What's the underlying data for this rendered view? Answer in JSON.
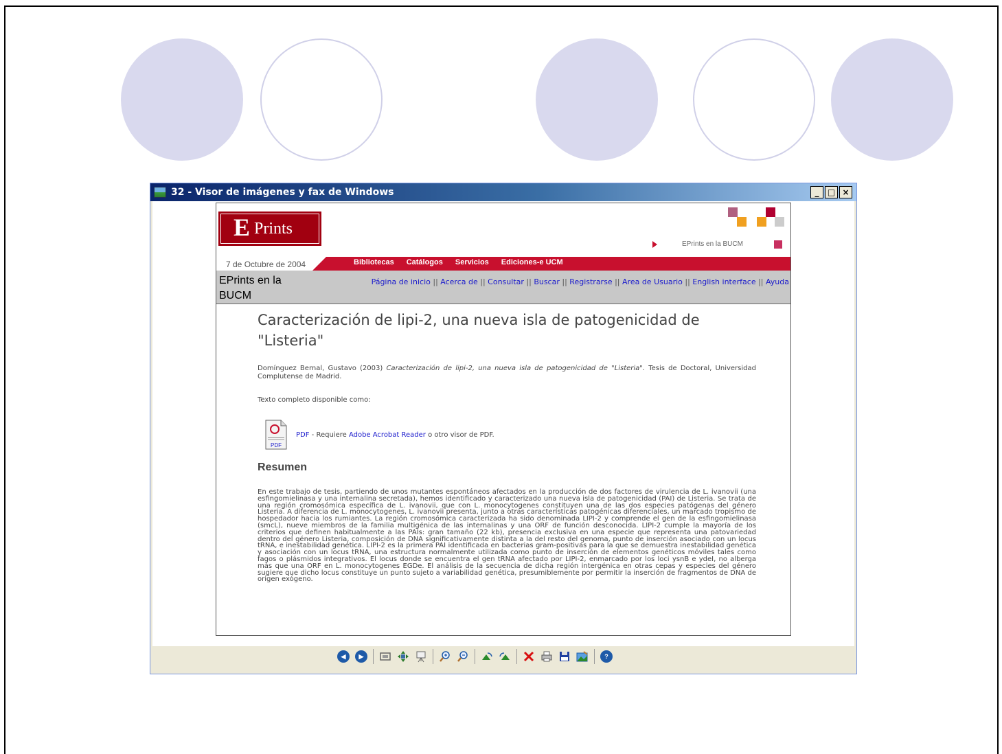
{
  "window": {
    "title": "32 - Visor de imágenes y fax de Windows",
    "min_label": "_",
    "max_label": "□",
    "close_label": "×"
  },
  "page": {
    "logo_letter": "E",
    "logo_rest": "Prints",
    "eprints_link": "EPrints en la BUCM",
    "date": "7 de Octubre de 2004",
    "nav": [
      "Bibliotecas",
      "Catálogos",
      "Servicios",
      "Ediciones-e UCM"
    ],
    "site_name": "EPrints en la BUCM",
    "top_links": [
      "Página de inicio",
      "Acerca de",
      "Consultar",
      "Buscar",
      "Registrarse",
      "Area de Usuario",
      "English interface",
      "Ayuda"
    ],
    "title": "Caracterización de lipi-2, una nueva isla de patogenicidad de \"Listeria\"",
    "citation_pre": "Domínguez Bernal, Gustavo (2003) ",
    "citation_italic": "Caracterización de lipi-2, una nueva isla de patogenicidad de \"Listeria\".",
    "citation_post": " Tesis de Doctoral, Universidad Complutense de Madrid.",
    "fulltext_label": "Texto completo disponible como:",
    "pdf_label": "PDF",
    "pdf_requires": " - Requiere ",
    "pdf_reader": "Adobe Acrobat Reader",
    "pdf_other": " o otro visor de PDF.",
    "pdf_icon_text": "PDF",
    "abstract_heading": "Resumen",
    "abstract": "En este trabajo de tesis, partiendo de unos mutantes espontáneos afectados en la producción de dos factores de virulencia de L. ivanovii (una esfingomielinasa y una internalina secretada), hemos identificado y caracterizado una nueva isla de patogenicidad (PAI) de Listeria. Se trata de una región cromosómica específica de L. ivanovii, que con L. monocytogenes constituyen una de las dos especies patógenas del género Listeria. A diferencia de L. monocytogenes, L. ivanovii presenta, junto a otras características patogénicas diferenciales, un marcado tropismo de hospedador hacia los rumiantes. La región cromosómica caracterizada ha sido denominada LIPI-2 y comprende el gen de la esfingomielinasa (smcL), nueve miembros de la familia multigénica de las internalinas y una ORF de función desconocida. LIPI-2 cumple la mayoría de los criterios que definen habitualmente a las PAIs: gran tamaño (22 kb), presencia exclusiva en una especie que representa una patovariedad dentro del género Listeria, composición de DNA significativamente distinta a la del resto del genoma, punto de inserción asociado con un locus tRNA, e inestabilidad genética. LIPI-2 es la primera PAI identificada en bacterias gram-positivas para la que se demuestra inestabilidad genética y asociación con un locus tRNA, una estructura normalmente utilizada como punto de inserción de elementos genéticos móviles tales como fagos o plásmidos integrativos. El locus donde se encuentra el gen tRNA afectado por LIPI-2, enmarcado por los loci ysnB e ydeI, no alberga más que una ORF en L. monocytogenes EGDe. El análisis de la secuencia de dicha región intergénica en otras cepas y especies del género sugiere que dicho locus constituye un punto sujeto a variabilidad genética, presumiblemente por permitir la inserción de fragmentos de DNA de origen exógeno."
  },
  "toolbar": {
    "prev_label": "◀",
    "next_label": "▶",
    "help_label": "?",
    "icons": [
      "previous-image-icon",
      "next-image-icon",
      "best-fit-icon",
      "actual-size-icon",
      "slideshow-icon",
      "zoom-in-icon",
      "zoom-out-icon",
      "rotate-clockwise-icon",
      "rotate-counterclockwise-icon",
      "delete-icon",
      "print-icon",
      "save-icon",
      "edit-icon",
      "help-icon"
    ]
  },
  "colors": {
    "circle_fill": "#d9d9ee",
    "circle_outline": "#d0d0e8",
    "brand_red": "#c8102e",
    "titlebar": "#0a246a",
    "link_blue": "#1a1acc"
  }
}
